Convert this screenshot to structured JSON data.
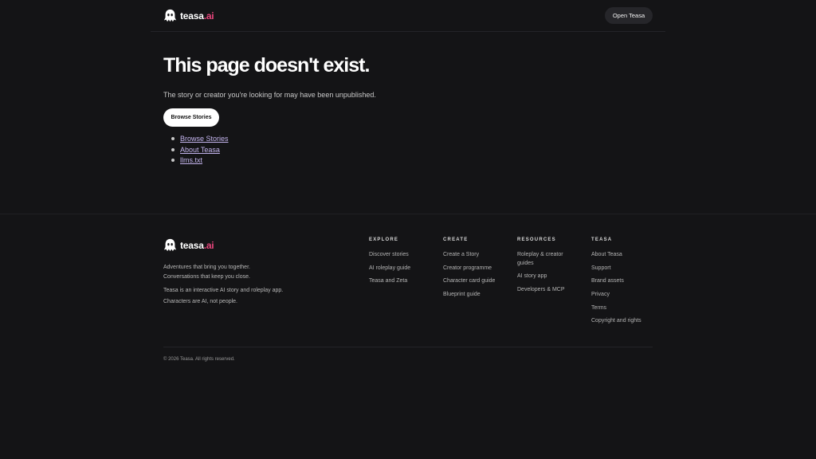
{
  "header": {
    "brand": {
      "name": "teasa",
      "suffix": ".ai"
    },
    "open_button": "Open Teasa"
  },
  "main": {
    "title": "This page doesn't exist.",
    "subtitle": "The story or creator you're looking for may have been unpublished.",
    "browse_button": "Browse Stories",
    "links": [
      "Browse Stories",
      "About Teasa",
      "llms.txt"
    ]
  },
  "footer": {
    "brand": {
      "name": "teasa",
      "suffix": ".ai"
    },
    "tagline": [
      "Adventures that bring you together.",
      "Conversations that keep you close."
    ],
    "description": [
      "Teasa is an interactive AI story and roleplay app.",
      "Characters are AI, not people."
    ],
    "columns": [
      {
        "title": "EXPLORE",
        "items": [
          "Discover stories",
          "AI roleplay guide",
          "Teasa and Zeta"
        ]
      },
      {
        "title": "CREATE",
        "items": [
          "Create a Story",
          "Creator programme",
          "Character card guide",
          "Blueprint guide"
        ]
      },
      {
        "title": "RESOURCES",
        "items": [
          "Roleplay & creator guides",
          "AI story app",
          "Developers & MCP"
        ]
      },
      {
        "title": "TEASA",
        "items": [
          "About Teasa",
          "Support",
          "Brand assets",
          "Privacy",
          "Terms",
          "Copyright and rights"
        ]
      }
    ],
    "copyright": "© 2026 Teasa. All rights reserved."
  },
  "colors": {
    "background": "#141416",
    "accent": "#e8467c",
    "link": "#c4b5ee"
  },
  "icons": {
    "logo": "ghost-icon"
  }
}
